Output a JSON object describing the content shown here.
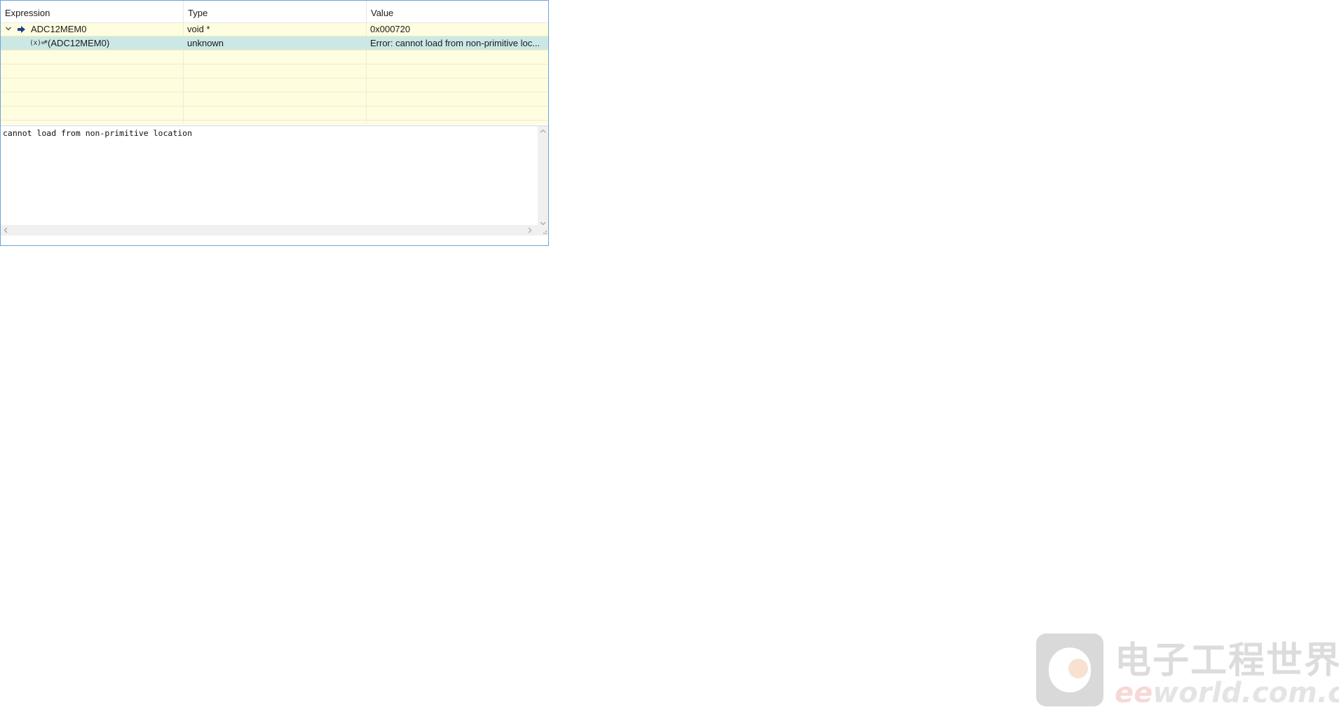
{
  "expressions_view": {
    "columns": [
      "Expression",
      "Type",
      "Value"
    ],
    "rows": [
      {
        "expression": "ADC12MEM0",
        "type": "void *",
        "value": "0x000720",
        "expanded": true,
        "icon": "arrow-right-icon"
      },
      {
        "expression": "*(ADC12MEM0)",
        "type": "unknown",
        "value": "Error: cannot load from non-primitive loc...",
        "selected": true,
        "icon": "variable-icon",
        "icon_text": "(x)="
      }
    ]
  },
  "detail_pane": {
    "text": "cannot load from non-primitive location"
  },
  "watermark": {
    "cn": "电子工程世界",
    "en_prefix": "ee",
    "en_rest": "world.com.cn"
  },
  "colors": {
    "table_bg": "#fffde0",
    "selected_row": "#cce8e4",
    "panel_border": "#6ea2d8",
    "arrow_blue": "#1f3f8f"
  }
}
